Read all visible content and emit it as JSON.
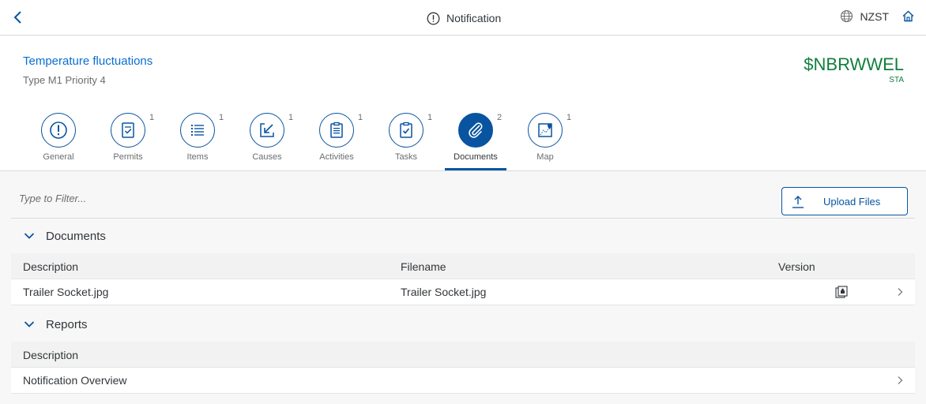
{
  "shell": {
    "title": "Notification",
    "timezone": "NZST"
  },
  "header": {
    "title": "Temperature fluctuations",
    "subtitle": "Type M1 Priority 4",
    "number": "$NBRWWEL",
    "unit": "STA"
  },
  "tabs": [
    {
      "label": "General",
      "count": "",
      "icon": "alert-circle-icon"
    },
    {
      "label": "Permits",
      "count": "1",
      "icon": "permit-document-icon"
    },
    {
      "label": "Items",
      "count": "1",
      "icon": "list-icon"
    },
    {
      "label": "Causes",
      "count": "1",
      "icon": "causes-icon"
    },
    {
      "label": "Activities",
      "count": "1",
      "icon": "clipboard-list-icon"
    },
    {
      "label": "Tasks",
      "count": "1",
      "icon": "clipboard-check-icon"
    },
    {
      "label": "Documents",
      "count": "2",
      "icon": "paperclip-icon",
      "selected": true
    },
    {
      "label": "Map",
      "count": "1",
      "icon": "map-icon"
    }
  ],
  "toolbar": {
    "filter_placeholder": "Type to Filter...",
    "upload_label": "Upload Files"
  },
  "documents": {
    "group_title": "Documents",
    "columns": [
      "Description",
      "Filename",
      "Version"
    ],
    "rows": [
      {
        "description": "Trailer Socket.jpg",
        "filename": "Trailer Socket.jpg",
        "version_icon": "document-version-icon"
      }
    ]
  },
  "reports": {
    "group_title": "Reports",
    "columns": [
      "Description"
    ],
    "rows": [
      {
        "description": "Notification Overview"
      }
    ]
  },
  "colors": {
    "accent": "#0854a0",
    "link": "#0a6ed1",
    "positive": "#107e3e"
  }
}
